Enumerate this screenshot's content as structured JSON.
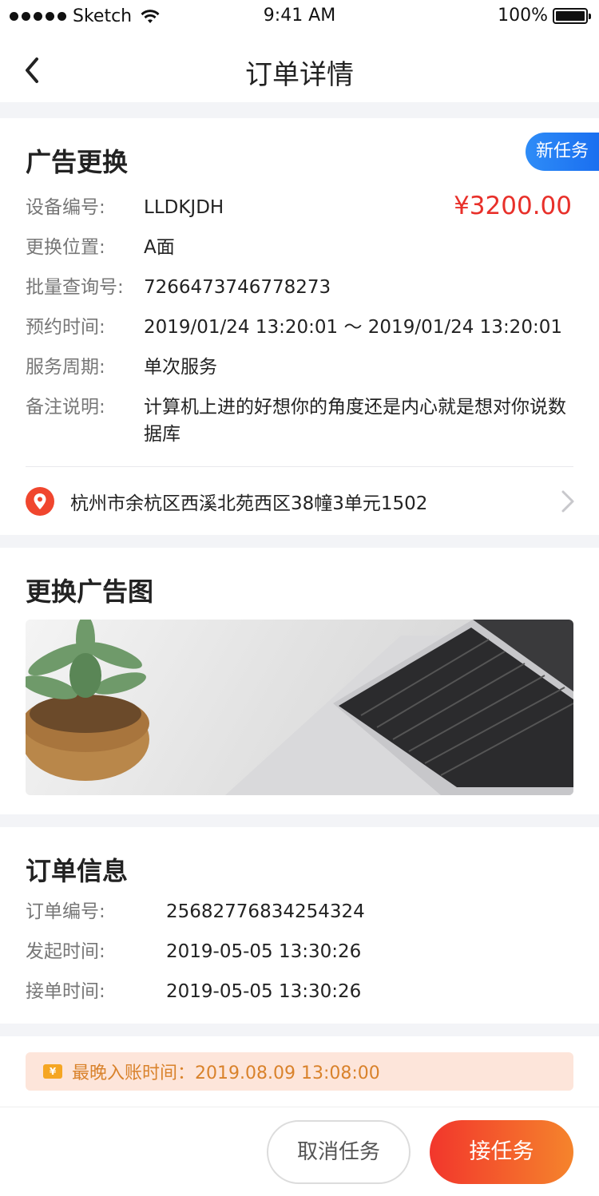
{
  "status_bar": {
    "carrier": "Sketch",
    "time": "9:41 AM",
    "battery": "100%"
  },
  "nav": {
    "title": "订单详情"
  },
  "ad_card": {
    "title": "广告更换",
    "badge": "新任务",
    "price": "¥3200.00",
    "rows": [
      {
        "label": "设备编号:",
        "value": "LLDKJDH"
      },
      {
        "label": "更换位置:",
        "value": "A面"
      },
      {
        "label": "批量查询号:",
        "value": "7266473746778273"
      },
      {
        "label": "预约时间:",
        "value": "2019/01/24 13:20:01 ～ 2019/01/24 13:20:01"
      },
      {
        "label": "服务周期:",
        "value": "单次服务"
      },
      {
        "label": "备注说明:",
        "value": "计算机上进的好想你的角度还是内心就是想对你说数据库"
      }
    ],
    "address": "杭州市余杭区西溪北苑西区38幢3单元1502"
  },
  "image_card": {
    "title": "更换广告图"
  },
  "order_card": {
    "title": "订单信息",
    "rows": [
      {
        "label": "订单编号:",
        "value": "25682776834254324"
      },
      {
        "label": "发起时间:",
        "value": "2019-05-05 13:30:26"
      },
      {
        "label": "接单时间:",
        "value": "2019-05-05 13:30:26"
      }
    ]
  },
  "notice": {
    "icon_text": "¥",
    "text": "最晚入账时间：2019.08.09   13:08:00"
  },
  "actions": {
    "cancel_label": "取消任务",
    "accept_label": "接任务"
  }
}
